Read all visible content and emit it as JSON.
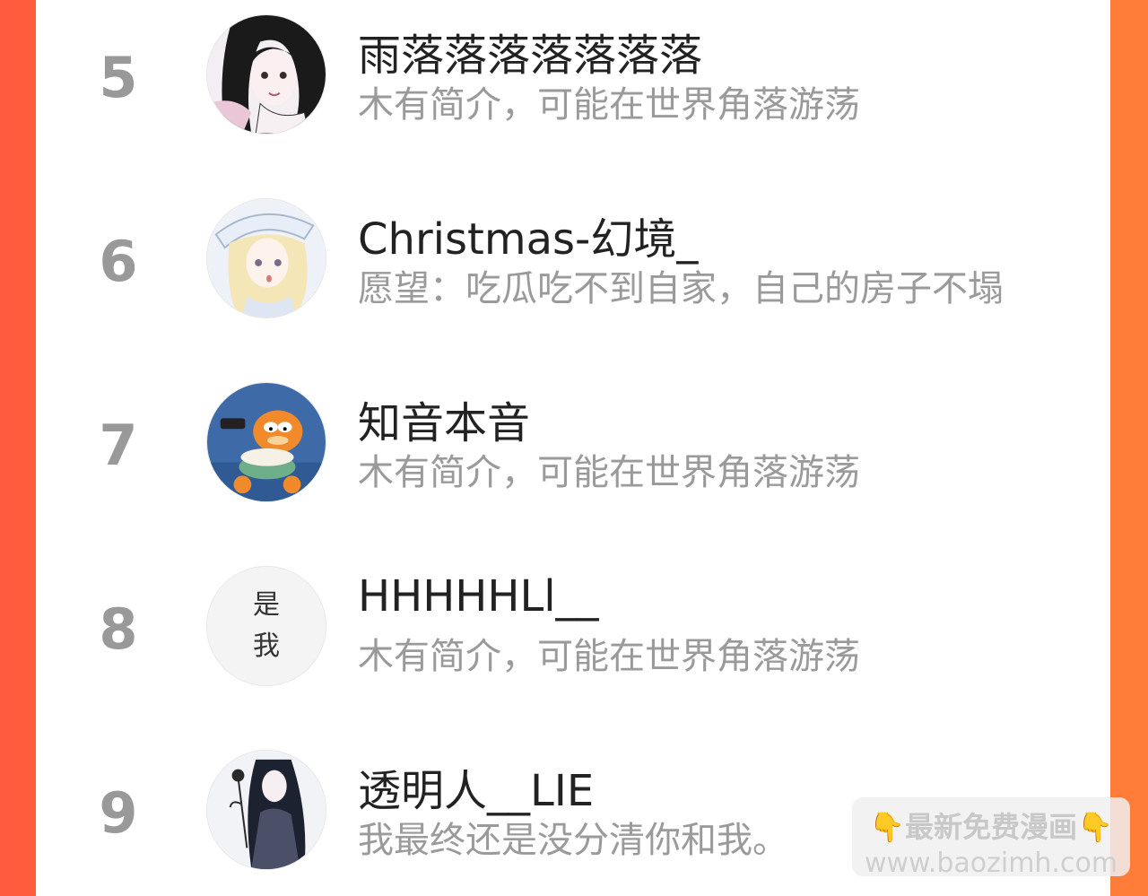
{
  "ranking": [
    {
      "rank": "5",
      "name": "雨落落落落落落落",
      "bio": "木有简介，可能在世界角落游荡",
      "avatar_icon": "anime-girl-dark-hair-avatar-icon"
    },
    {
      "rank": "6",
      "name": "Christmas-幻境_",
      "bio": "愿望：吃瓜吃不到自家，自己的房子不塌",
      "avatar_icon": "anime-girl-blonde-hat-avatar-icon"
    },
    {
      "rank": "7",
      "name": "知音本音",
      "bio": "木有简介，可能在世界角落游荡",
      "avatar_icon": "garfield-popcorn-avatar-icon"
    },
    {
      "rank": "8",
      "name": "HHHHHLl__",
      "bio": "木有简介，可能在世界角落游荡",
      "avatar_icon": "text-avatar-icon",
      "avatar_text": [
        "是",
        "我"
      ]
    },
    {
      "rank": "9",
      "name": "透明人__LIE",
      "bio": "我最终还是没分清你和我。",
      "avatar_icon": "girl-with-flower-avatar-icon"
    }
  ],
  "watermark": {
    "title": "最新免费漫画",
    "hand_left": "👇",
    "hand_right": "👇",
    "url": "www.baozimh.com"
  },
  "colors": {
    "background_gradient_start": "#ff5b3e",
    "background_gradient_end": "#ff7d39",
    "rank_color": "#999999",
    "name_color": "#222222",
    "bio_color": "#9a9a9a"
  }
}
